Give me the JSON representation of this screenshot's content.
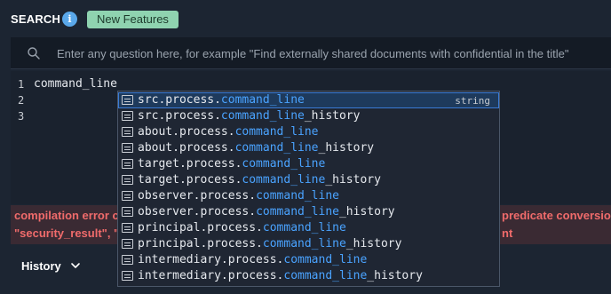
{
  "header": {
    "title": "SEARCH",
    "info_icon": "i",
    "badge": "New Features"
  },
  "search": {
    "placeholder": "Enter any question here, for example \"Find externally shared documents with confidential in the title\"",
    "value": ""
  },
  "editor": {
    "line_numbers": [
      "1",
      "2",
      "3"
    ],
    "code": "command_line"
  },
  "error": {
    "line1_left": "compilation error c",
    "line1_right": "predicate conversion",
    "line2_left": "\"security_result\", \"",
    "line2_right": "nt"
  },
  "history": {
    "label": "History"
  },
  "autocomplete": {
    "match": "command_line",
    "items": [
      {
        "prefix": "src.process.",
        "suffix": "",
        "type": "string"
      },
      {
        "prefix": "src.process.",
        "suffix": "_history",
        "type": ""
      },
      {
        "prefix": "about.process.",
        "suffix": "",
        "type": ""
      },
      {
        "prefix": "about.process.",
        "suffix": "_history",
        "type": ""
      },
      {
        "prefix": "target.process.",
        "suffix": "",
        "type": ""
      },
      {
        "prefix": "target.process.",
        "suffix": "_history",
        "type": ""
      },
      {
        "prefix": "observer.process.",
        "suffix": "",
        "type": ""
      },
      {
        "prefix": "observer.process.",
        "suffix": "_history",
        "type": ""
      },
      {
        "prefix": "principal.process.",
        "suffix": "",
        "type": ""
      },
      {
        "prefix": "principal.process.",
        "suffix": "_history",
        "type": ""
      },
      {
        "prefix": "intermediary.process.",
        "suffix": "",
        "type": ""
      },
      {
        "prefix": "intermediary.process.",
        "suffix": "_history",
        "type": ""
      }
    ]
  },
  "colors": {
    "background": "#1c2532",
    "accent": "#4aa3ff",
    "badge": "#8fd3b0",
    "error": "#f06b6b",
    "info": "#5aa8ea"
  }
}
